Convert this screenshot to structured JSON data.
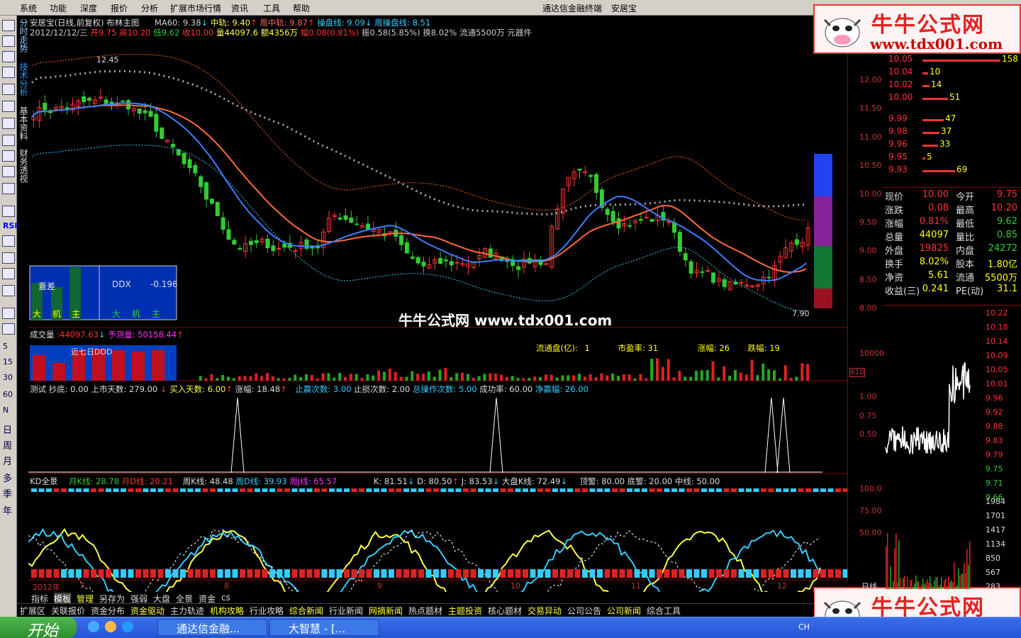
{
  "menu": {
    "items": [
      "系统",
      "功能",
      "深度",
      "报价",
      "分析",
      "扩展市场行情",
      "资讯",
      "工具",
      "帮助"
    ],
    "window_title": "通达信金融终端",
    "stock_name": "安居宝"
  },
  "logo": {
    "name": "牛牛公式网",
    "url": "www.tdx001.com"
  },
  "watermark": {
    "text": "牛牛公式网 www.tdx001.com"
  },
  "side_tabs": [
    "分时走势",
    "技术分析",
    "基本资料",
    "财务透视"
  ],
  "left_toolbar_labels": [
    "RSI",
    "5",
    "15",
    "30",
    "60",
    "N",
    "日",
    "周",
    "月",
    "多",
    "季",
    "年"
  ],
  "main_header": {
    "title": "安居宝(日线,前复权) 布林主图",
    "ma60": "MA60: 9.38",
    "mid": "中轨: 9.40",
    "week_mid": "周中轨: 9.87",
    "op_line": "操盘线: 9.09",
    "week_op": "周操盘线: 8.51",
    "date": "2012/12/12/三",
    "open": "开9.75",
    "high": "高10.20",
    "low": "低9.62",
    "close": "收10.00",
    "vol": "量44097.6",
    "amount": "额4356万",
    "pct": "幅0.08(0.81%)",
    "amp": "振0.58(5.85%)",
    "turnover": "换8.02%",
    "float": "流通5500万",
    "sector": "元器件"
  },
  "price_annotations": {
    "high": "12.45",
    "low": "7.90"
  },
  "ddx_box": {
    "label1": "蓋差",
    "label2": "DDX",
    "value": "-0.196",
    "bars": [
      "大",
      "机",
      "主"
    ],
    "bars2": [
      "大",
      "机",
      "主"
    ]
  },
  "price_axis": [
    "12.00",
    "11.50",
    "11.00",
    "10.50",
    "10.00",
    "9.50",
    "9.00",
    "8.50",
    "8.00"
  ],
  "volume_panel": {
    "title": "成交量",
    "vol": ":44097.63",
    "pred": "予测量: 50158.44",
    "ddd": "近七日DDD",
    "float_label": "流通盘(亿):",
    "float_val": "1",
    "pe_label": "市盈率:",
    "pe_val": "31",
    "up_label": "涨幅:",
    "up_val": "26",
    "down_label": "跌幅:",
    "down_val": "19",
    "axis": "10000",
    "x10": "X10"
  },
  "test_panel": {
    "t1": "测试",
    "t2": "抄底: 0.00",
    "t3": "上市天数: 279.00",
    "t4": "买入天数: 6.00",
    "t5": "涨幅: 18.48",
    "t6": "止赢次数: 3.00",
    "t7": "止损次数: 2.00",
    "t8": "总操作次数: 5.00",
    "t9": "成功率: 60.00",
    "t10": "净赢幅: 26.00",
    "axis": [
      "1.00",
      "0.75",
      "0.50"
    ]
  },
  "kd_panel": {
    "title": "KD全景",
    "mk": "月K线: 28.78",
    "md": "月D线: 20.21",
    "wk": "周K线: 48.48",
    "wd": "周D线: 39.93",
    "wj": "周J线: 65.57",
    "k": "K: 81.51",
    "d": "D: 80.50",
    "j": "J: 83.53",
    "dk": "大盘K线: 72.49",
    "top": "顶警: 80.00",
    "bottom": "底警: 20.00",
    "mid": "中线: 50.00",
    "axis": [
      "100.0",
      "75.00",
      "50.00"
    ]
  },
  "date_axis": [
    "2012年",
    "7",
    "8",
    "9",
    "10",
    "11",
    "12"
  ],
  "order_book": [
    {
      "price": "10.05",
      "vol": "158",
      "bar": 110
    },
    {
      "price": "10.04",
      "vol": "10",
      "bar": 8
    },
    {
      "price": "10.02",
      "vol": "14",
      "bar": 10
    },
    {
      "price": "10.00",
      "vol": "51",
      "bar": 36
    },
    {
      "price": "9.99",
      "vol": "47",
      "bar": 30
    },
    {
      "price": "9.98",
      "vol": "37",
      "bar": 24
    },
    {
      "price": "9.96",
      "vol": "33",
      "bar": 22
    },
    {
      "price": "9.95",
      "vol": "5",
      "bar": 4
    },
    {
      "price": "9.93",
      "vol": "69",
      "bar": 46
    }
  ],
  "stats": [
    {
      "l": "现价",
      "v": "10.00",
      "vc": "#f33",
      "l2": "今开",
      "v2": "9.75",
      "v2c": "#f33"
    },
    {
      "l": "涨跌",
      "v": "0.08",
      "vc": "#f33",
      "l2": "最高",
      "v2": "10.20",
      "v2c": "#f33"
    },
    {
      "l": "涨幅",
      "v": "0.81%",
      "vc": "#f33",
      "l2": "最低",
      "v2": "9.62",
      "v2c": "#3c3"
    },
    {
      "l": "总量",
      "v": "44097",
      "vc": "#ff0",
      "l2": "量比",
      "v2": "0.85",
      "v2c": "#3c3"
    },
    {
      "l": "外盘",
      "v": "19825",
      "vc": "#f33",
      "l2": "内盘",
      "v2": "24272",
      "v2c": "#3c3"
    },
    {
      "l": "换手",
      "v": "8.02%",
      "vc": "#ff0",
      "l2": "股本",
      "v2": "1.80亿",
      "v2c": "#ff0"
    },
    {
      "l": "净资",
      "v": "5.61",
      "vc": "#ff0",
      "l2": "流通",
      "v2": "5500万",
      "v2c": "#ff0"
    },
    {
      "l": "收益(三)",
      "v": "0.241",
      "vc": "#ff0",
      "l2": "PE(动)",
      "v2": "31.1",
      "v2c": "#ff0"
    }
  ],
  "mini_axis_prices": [
    "10.22",
    "10.18",
    "10.14",
    "10.09",
    "10.05",
    "10.01",
    "9.96",
    "9.92",
    "9.88",
    "9.83",
    "9.79",
    "9.75",
    "9.71",
    "9.66"
  ],
  "mini_axis_vols": [
    "1984",
    "1701",
    "1417",
    "1134",
    "850",
    "567",
    "283"
  ],
  "mini_label": "日线",
  "bottom_tabs": [
    "指标",
    "模板",
    "管理",
    "另存为",
    "强弱",
    "大盘",
    "全景",
    "资金",
    "cs"
  ],
  "bottom_tabs2": [
    "扩展区",
    "关联报价",
    "资金分布",
    "资金驱动",
    "主力轨迹",
    "机构攻略",
    "行业攻略",
    "综合新闻",
    "行业新闻",
    "网摘新闻",
    "热点题材",
    "主题投资",
    "核心题材",
    "交易异动",
    "公司公告",
    "公司新闻",
    "综合工具"
  ],
  "taskbar": {
    "start": "开始",
    "tasks": [
      "通达信金融...",
      "大智慧 - [..."
    ],
    "lang": "CH"
  },
  "colors": {
    "up": "#ff3333",
    "down": "#33cc33",
    "ma_blue": "#3a7fff",
    "ma_orange": "#ff6a3a"
  }
}
